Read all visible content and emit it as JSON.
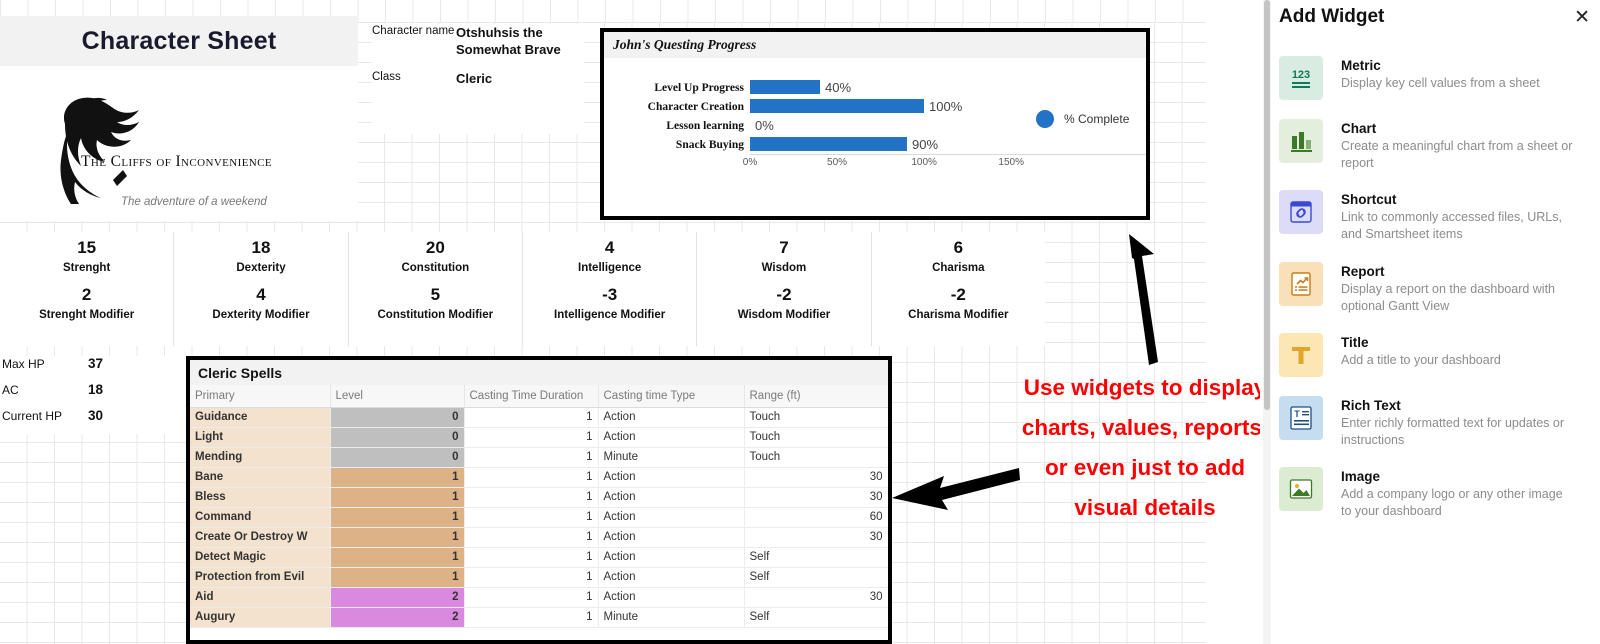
{
  "dashboard": {
    "title_widget": {
      "text": "Character Sheet"
    },
    "logo": {
      "name": "The Cliffs of Inconvenience",
      "tagline": "The adventure of a weekend",
      "icon": "dragon-logo"
    },
    "meta": [
      {
        "key": "Character name",
        "value": "Otshuhsis the Somewhat Brave"
      },
      {
        "key": "Class",
        "value": "Cleric"
      }
    ],
    "stats": [
      {
        "score": "15",
        "name": "Strenght",
        "modifier": "2",
        "modifier_label": "Strenght Modifier"
      },
      {
        "score": "18",
        "name": "Dexterity",
        "modifier": "4",
        "modifier_label": "Dexterity Modifier"
      },
      {
        "score": "20",
        "name": "Constitution",
        "modifier": "5",
        "modifier_label": "Constitution Modifier"
      },
      {
        "score": "4",
        "name": "Intelligence",
        "modifier": "-3",
        "modifier_label": "Intelligence Modifier"
      },
      {
        "score": "7",
        "name": "Wisdom",
        "modifier": "-2",
        "modifier_label": "Wisdom Modifier"
      },
      {
        "score": "6",
        "name": "Charisma",
        "modifier": "-2",
        "modifier_label": "Charisma Modifier"
      }
    ],
    "hp": [
      {
        "key": "Max HP",
        "value": "37"
      },
      {
        "key": "AC",
        "value": "18"
      },
      {
        "key": "Current  HP",
        "value": "30"
      }
    ],
    "spells": {
      "title": "Cleric Spells",
      "columns": [
        "Primary",
        "Level",
        "Casting Time Duration",
        "Casting time Type",
        "Range (ft)"
      ],
      "rows": [
        {
          "primary": "Guidance",
          "level": "0",
          "duration": "1",
          "type": "Action",
          "range": "Touch",
          "range_numeric": false
        },
        {
          "primary": "Light",
          "level": "0",
          "duration": "1",
          "type": "Action",
          "range": "Touch",
          "range_numeric": false
        },
        {
          "primary": "Mending",
          "level": "0",
          "duration": "1",
          "type": "Minute",
          "range": "Touch",
          "range_numeric": false
        },
        {
          "primary": "Bane",
          "level": "1",
          "duration": "1",
          "type": "Action",
          "range": "30",
          "range_numeric": true
        },
        {
          "primary": "Bless",
          "level": "1",
          "duration": "1",
          "type": "Action",
          "range": "30",
          "range_numeric": true
        },
        {
          "primary": "Command",
          "level": "1",
          "duration": "1",
          "type": "Action",
          "range": "60",
          "range_numeric": true
        },
        {
          "primary": "Create Or Destroy W",
          "level": "1",
          "duration": "1",
          "type": "Action",
          "range": "30",
          "range_numeric": true
        },
        {
          "primary": "Detect Magic",
          "level": "1",
          "duration": "1",
          "type": "Action",
          "range": "Self",
          "range_numeric": false
        },
        {
          "primary": "Protection from Evil",
          "level": "1",
          "duration": "1",
          "type": "Action",
          "range": "Self",
          "range_numeric": false
        },
        {
          "primary": "Aid",
          "level": "2",
          "duration": "1",
          "type": "Action",
          "range": "30",
          "range_numeric": true
        },
        {
          "primary": "Augury",
          "level": "2",
          "duration": "1",
          "type": "Minute",
          "range": "Self",
          "range_numeric": false
        }
      ],
      "level_colors": {
        "0": "#bfbfbf",
        "1": "#ddb287",
        "2": "#d98ade"
      },
      "primary_color": "#f3e2ce"
    },
    "annotation": {
      "text": "Use widgets to display charts, values, reports, or even just to add visual details",
      "color": "#ff0000"
    }
  },
  "chart_data": {
    "type": "bar",
    "orientation": "horizontal",
    "title": "John's Questing Progress",
    "categories": [
      "Level Up Progress",
      "Character Creation",
      "Lesson learning",
      "Snack Buying"
    ],
    "values": [
      40,
      100,
      0,
      90
    ],
    "data_labels": [
      "40%",
      "100%",
      "0%",
      "90%"
    ],
    "series": [
      {
        "name": "% Complete",
        "values": [
          40,
          100,
          0,
          90
        ],
        "color": "#2272c5"
      }
    ],
    "xlabel": "",
    "ylabel": "",
    "xlim": [
      0,
      170
    ],
    "tick_labels": [
      "0%",
      "50%",
      "100%",
      "150%"
    ],
    "tick_values": [
      0,
      50,
      100,
      150
    ],
    "legend": {
      "position": "right",
      "entries": [
        "% Complete"
      ]
    },
    "grid": false
  },
  "panel": {
    "title": "Add Widget",
    "close_label": "✕",
    "items": [
      {
        "name": "Metric",
        "desc": "Display key cell values from a sheet",
        "icon": "numbers-123-icon",
        "bg": "#d9ece2",
        "fg": "#0f7a5a"
      },
      {
        "name": "Chart",
        "desc": "Create a meaningful chart from a sheet or report",
        "icon": "bar-chart-icon",
        "bg": "#e3efdc",
        "fg": "#3d7a28"
      },
      {
        "name": "Shortcut",
        "desc": "Link to commonly accessed files, URLs, and Smartsheet items",
        "icon": "link-icon",
        "bg": "#dcdcf7",
        "fg": "#3b4ad1"
      },
      {
        "name": "Report",
        "desc": "Display a report on the dashboard with optional Gantt View",
        "icon": "report-icon",
        "bg": "#fae0b8",
        "fg": "#c97b15"
      },
      {
        "name": "Title",
        "desc": "Add a title to your dashboard",
        "icon": "title-T-icon",
        "bg": "#fbe6b4",
        "fg": "#e0a62c"
      },
      {
        "name": "Rich Text",
        "desc": "Enter richly formatted text for updates or instructions",
        "icon": "rich-text-icon",
        "bg": "#c6dcef",
        "fg": "#1e4f87"
      },
      {
        "name": "Image",
        "desc": "Add a company logo or any other image to your dashboard",
        "icon": "image-icon",
        "bg": "#dcecd2",
        "fg": "#3d7a28"
      }
    ]
  }
}
